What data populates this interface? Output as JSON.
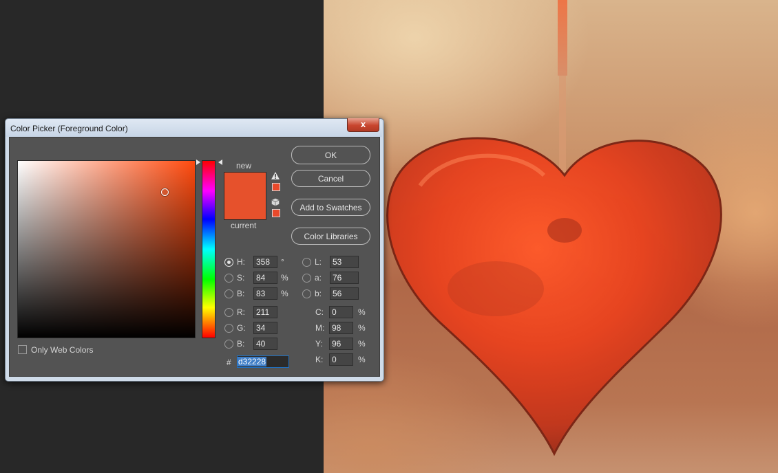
{
  "dialog": {
    "title": "Color Picker (Foreground Color)",
    "close_label": "x",
    "new_label": "new",
    "current_label": "current",
    "new_color": "#e6512c",
    "warning_color": "#e8492b",
    "websafe_color": "#e8492b",
    "hue_base_color": "#ff4a0e"
  },
  "buttons": {
    "ok": "OK",
    "cancel": "Cancel",
    "add_swatches": "Add to Swatches",
    "color_libraries": "Color Libraries"
  },
  "hsb": {
    "h_label": "H:",
    "h_value": "358",
    "h_unit": "°",
    "s_label": "S:",
    "s_value": "84",
    "s_unit": "%",
    "b_label": "B:",
    "b_value": "83",
    "b_unit": "%"
  },
  "rgb": {
    "r_label": "R:",
    "r_value": "211",
    "g_label": "G:",
    "g_value": "34",
    "b_label": "B:",
    "b_value": "40"
  },
  "lab": {
    "l_label": "L:",
    "l_value": "53",
    "a_label": "a:",
    "a_value": "76",
    "b_label": "b:",
    "b_value": "56"
  },
  "cmyk": {
    "c_label": "C:",
    "c_value": "0",
    "c_unit": "%",
    "m_label": "M:",
    "m_value": "98",
    "m_unit": "%",
    "y_label": "Y:",
    "y_value": "96",
    "y_unit": "%",
    "k_label": "K:",
    "k_value": "0",
    "k_unit": "%"
  },
  "hex": {
    "hash": "#",
    "value": "d32228"
  },
  "only_web_colors": "Only Web Colors"
}
